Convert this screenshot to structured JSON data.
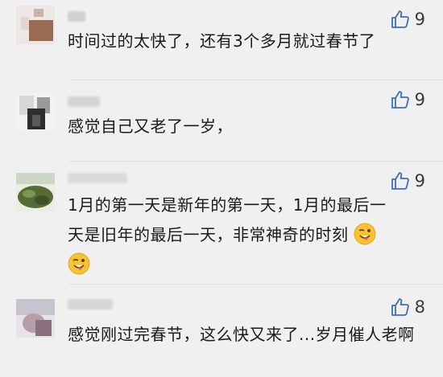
{
  "comments": [
    {
      "likes": "9",
      "text": "时间过的太快了，还有3个多月就过春节了"
    },
    {
      "likes": "9",
      "text": "感觉自己又老了一岁，"
    },
    {
      "likes": "9",
      "text": "1月的第一天是新年的第一天，1月的最后一天是旧年的最后一天，非常神奇的时刻"
    },
    {
      "likes": "8",
      "text": "感觉刚过完春节，这么快又来了...岁月催人老啊"
    }
  ],
  "icons": {
    "like": "thumbs-up-icon",
    "emoji": "tongue-wink-emoji-icon"
  },
  "colors": {
    "background": "#f0f0f0",
    "like_icon": "#3b6fb6"
  }
}
